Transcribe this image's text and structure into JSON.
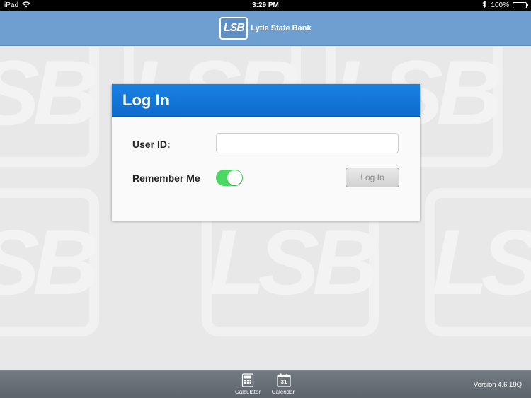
{
  "status_bar": {
    "device": "iPad",
    "time": "3:29 PM",
    "battery": "100%"
  },
  "header": {
    "logo_mark": "LSB",
    "bank_name": "Lytle State Bank"
  },
  "background": {
    "watermark_text": "LSB"
  },
  "login": {
    "title": "Log In",
    "user_id_label": "User ID:",
    "user_id_value": "",
    "user_id_placeholder": "",
    "remember_label": "Remember Me",
    "remember_on": true,
    "button_label": "Log In"
  },
  "tabbar": {
    "calculator_label": "Calculator",
    "calendar_label": "Calendar",
    "calendar_day": "31",
    "version": "Version 4.6.19Q"
  },
  "colors": {
    "header": "#6f9fd1",
    "card_header": "#1a82e4",
    "toggle_on": "#4cd864",
    "tabbar": "#666d74"
  },
  "icons": [
    "wifi-icon",
    "bluetooth-icon",
    "battery-icon",
    "calculator-icon",
    "calendar-icon"
  ]
}
